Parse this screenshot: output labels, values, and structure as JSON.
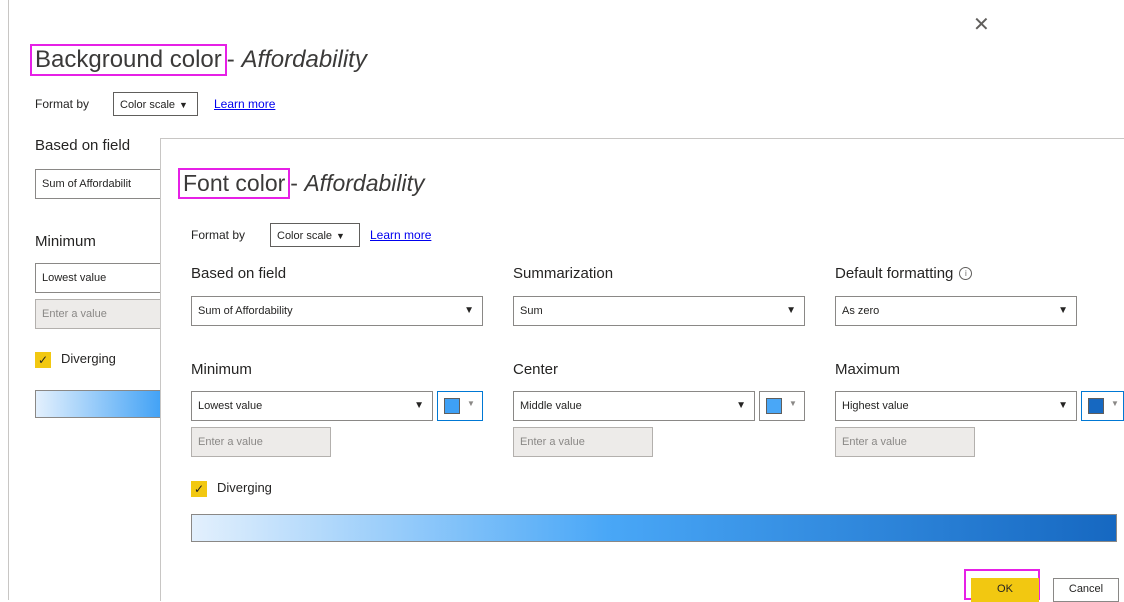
{
  "background_dialog": {
    "title_main": "Background color",
    "title_sep": "- ",
    "title_field": "Affordability",
    "format_by_label": "Format by",
    "format_by_value": "Color scale",
    "learn_more": "Learn more",
    "based_on_field_label": "Based on field",
    "based_on_field_value": "Sum of Affordabilit",
    "minimum_label": "Minimum",
    "minimum_value": "Lowest value",
    "minimum_input_placeholder": "Enter a value",
    "diverging_label": "Diverging"
  },
  "font_dialog": {
    "title_main": "Font color",
    "title_sep": "- ",
    "title_field": "Affordability",
    "format_by_label": "Format by",
    "format_by_value": "Color scale",
    "learn_more": "Learn more",
    "based_on_field_label": "Based on field",
    "based_on_field_value": "Sum of Affordability",
    "summarization_label": "Summarization",
    "summarization_value": "Sum",
    "default_formatting_label": "Default formatting",
    "default_formatting_value": "As zero",
    "minimum_label": "Minimum",
    "minimum_value": "Lowest value",
    "center_label": "Center",
    "center_value": "Middle value",
    "maximum_label": "Maximum",
    "maximum_value": "Highest value",
    "enter_value_placeholder": "Enter a value",
    "diverging_label": "Diverging",
    "ok_label": "OK",
    "cancel_label": "Cancel"
  },
  "colors": {
    "highlight": "#e620e6",
    "accent_yellow": "#f2c811",
    "min_color": "#3ea0f5",
    "center_color": "#49a7f7",
    "max_color": "#1668c1",
    "gradient_start": "#e3f0fd",
    "gradient_end": "#1668c1"
  },
  "icons": {
    "close": "close-icon",
    "info": "info-icon",
    "checkbox": "checkbox-checked-icon",
    "dropdown": "chevron-down-icon"
  }
}
